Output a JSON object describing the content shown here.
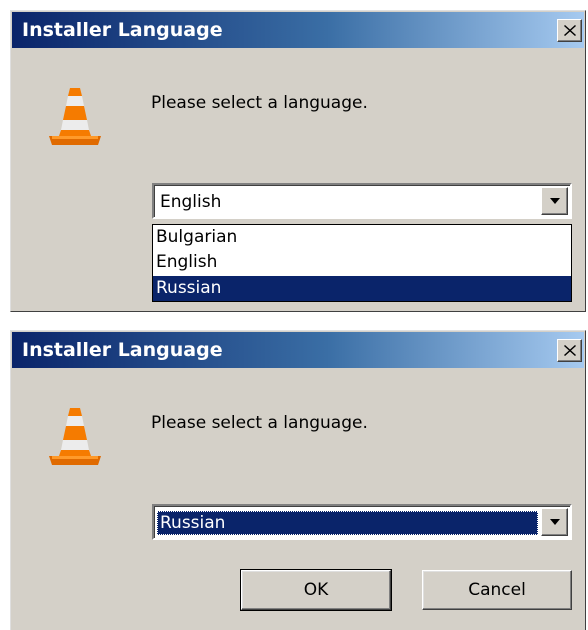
{
  "colors": {
    "title_bar_start": "#0a246a",
    "title_bar_end": "#a6caf0",
    "dialog_face": "#d4d0c8",
    "selection": "#0a246a"
  },
  "dialog_open": {
    "title": "Installer Language",
    "close_icon": "close-icon",
    "app_icon": "vlc-cone-icon",
    "prompt": "Please select a language.",
    "combo_value": "English",
    "options": [
      "Bulgarian",
      "English",
      "Russian"
    ],
    "highlighted_option": "Russian"
  },
  "dialog_selected": {
    "title": "Installer Language",
    "close_icon": "close-icon",
    "app_icon": "vlc-cone-icon",
    "prompt": "Please select a language.",
    "combo_value": "Russian",
    "ok_label": "OK",
    "cancel_label": "Cancel"
  }
}
